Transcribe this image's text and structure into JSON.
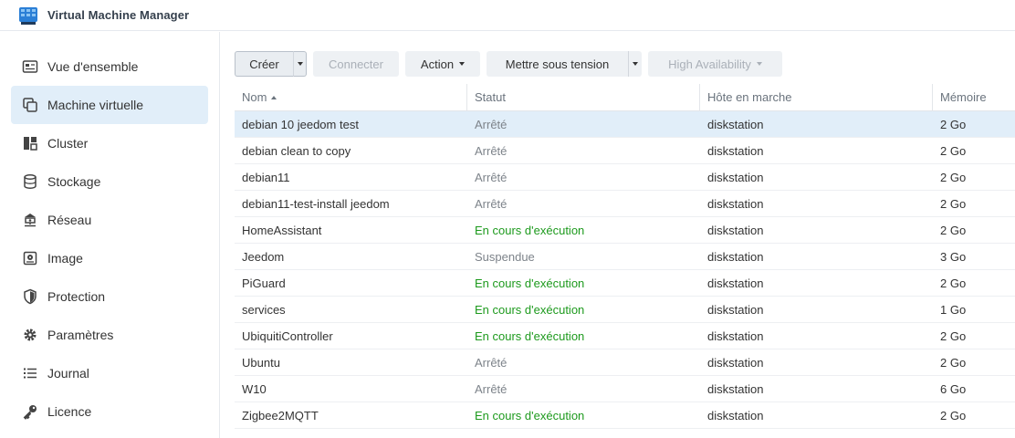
{
  "app": {
    "title": "Virtual Machine Manager"
  },
  "sidebar": {
    "items": [
      {
        "label": "Vue d'ensemble",
        "icon": "overview-icon"
      },
      {
        "label": "Machine virtuelle",
        "icon": "virtual-machine-icon",
        "active": true
      },
      {
        "label": "Cluster",
        "icon": "cluster-icon"
      },
      {
        "label": "Stockage",
        "icon": "storage-icon"
      },
      {
        "label": "Réseau",
        "icon": "network-icon"
      },
      {
        "label": "Image",
        "icon": "image-icon"
      },
      {
        "label": "Protection",
        "icon": "protection-icon"
      },
      {
        "label": "Paramètres",
        "icon": "settings-icon"
      },
      {
        "label": "Journal",
        "icon": "log-icon"
      },
      {
        "label": "Licence",
        "icon": "license-icon"
      }
    ]
  },
  "toolbar": {
    "create_label": "Créer",
    "connect_label": "Connecter",
    "action_label": "Action",
    "power_on_label": "Mettre sous tension",
    "ha_label": "High Availability"
  },
  "table": {
    "columns": {
      "name": "Nom",
      "status": "Statut",
      "host": "Hôte en marche",
      "memory": "Mémoire"
    },
    "rows": [
      {
        "name": "debian 10 jeedom test",
        "status": "Arrêté",
        "state": "stopped",
        "host": "diskstation",
        "memory": "2 Go",
        "selected": true
      },
      {
        "name": "debian clean to copy",
        "status": "Arrêté",
        "state": "stopped",
        "host": "diskstation",
        "memory": "2 Go"
      },
      {
        "name": "debian11",
        "status": "Arrêté",
        "state": "stopped",
        "host": "diskstation",
        "memory": "2 Go"
      },
      {
        "name": "debian11-test-install jeedom",
        "status": "Arrêté",
        "state": "stopped",
        "host": "diskstation",
        "memory": "2 Go"
      },
      {
        "name": "HomeAssistant",
        "status": "En cours d'exécution",
        "state": "running",
        "host": "diskstation",
        "memory": "2 Go"
      },
      {
        "name": "Jeedom",
        "status": "Suspendue",
        "state": "suspended",
        "host": "diskstation",
        "memory": "3 Go"
      },
      {
        "name": "PiGuard",
        "status": "En cours d'exécution",
        "state": "running",
        "host": "diskstation",
        "memory": "2 Go"
      },
      {
        "name": "services",
        "status": "En cours d'exécution",
        "state": "running",
        "host": "diskstation",
        "memory": "1 Go"
      },
      {
        "name": "UbiquitiController",
        "status": "En cours d'exécution",
        "state": "running",
        "host": "diskstation",
        "memory": "2 Go"
      },
      {
        "name": "Ubuntu",
        "status": "Arrêté",
        "state": "stopped",
        "host": "diskstation",
        "memory": "2 Go"
      },
      {
        "name": "W10",
        "status": "Arrêté",
        "state": "stopped",
        "host": "diskstation",
        "memory": "6 Go"
      },
      {
        "name": "Zigbee2MQTT",
        "status": "En cours d'exécution",
        "state": "running",
        "host": "diskstation",
        "memory": "2 Go"
      }
    ]
  },
  "colors": {
    "running": "#1d9a1d",
    "stopped": "#7d838a",
    "selected_bg": "#e1eef9",
    "accent": "#2b7fd6"
  }
}
